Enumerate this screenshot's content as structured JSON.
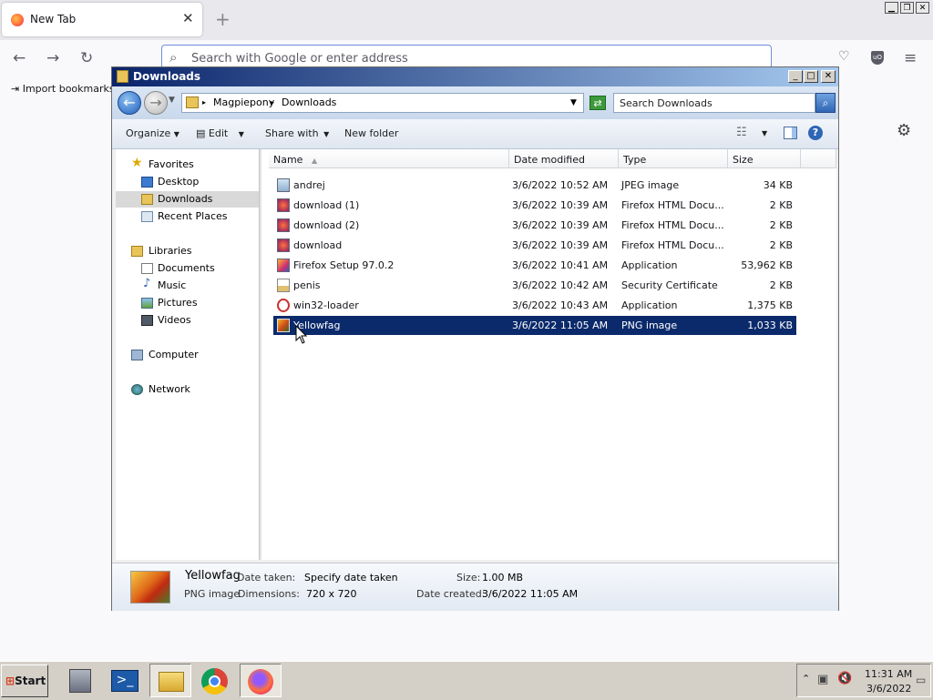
{
  "firefox": {
    "tab_title": "New Tab",
    "tab_close": "✕",
    "new_tab": "+",
    "address_placeholder": "Search with Google or enter address",
    "import_bookmarks": "Import bookmarks..."
  },
  "explorer": {
    "window_title": "Downloads",
    "breadcrumb": [
      "Magpiepony",
      "Downloads"
    ],
    "search_placeholder": "Search Downloads",
    "toolbar": {
      "organize": "Organize",
      "edit": "Edit",
      "share_with": "Share with",
      "new_folder": "New folder"
    },
    "nav": {
      "favorites": "Favorites",
      "desktop": "Desktop",
      "downloads": "Downloads",
      "recent_places": "Recent Places",
      "libraries": "Libraries",
      "documents": "Documents",
      "music": "Music",
      "pictures": "Pictures",
      "videos": "Videos",
      "computer": "Computer",
      "network": "Network"
    },
    "columns": {
      "name": "Name",
      "date_modified": "Date modified",
      "type": "Type",
      "size": "Size"
    },
    "files": [
      {
        "name": "andrej",
        "date": "3/6/2022 10:52 AM",
        "type": "JPEG image",
        "size": "34 KB",
        "icon": "image-file-icon"
      },
      {
        "name": "download (1)",
        "date": "3/6/2022 10:39 AM",
        "type": "Firefox HTML Docu...",
        "size": "2 KB",
        "icon": "html-file-icon"
      },
      {
        "name": "download (2)",
        "date": "3/6/2022 10:39 AM",
        "type": "Firefox HTML Docu...",
        "size": "2 KB",
        "icon": "html-file-icon"
      },
      {
        "name": "download",
        "date": "3/6/2022 10:39 AM",
        "type": "Firefox HTML Docu...",
        "size": "2 KB",
        "icon": "html-file-icon"
      },
      {
        "name": "Firefox Setup 97.0.2",
        "date": "3/6/2022 10:41 AM",
        "type": "Application",
        "size": "53,962 KB",
        "icon": "installer-icon"
      },
      {
        "name": "penis",
        "date": "3/6/2022 10:42 AM",
        "type": "Security Certificate",
        "size": "2 KB",
        "icon": "certificate-icon"
      },
      {
        "name": "win32-loader",
        "date": "3/6/2022 10:43 AM",
        "type": "Application",
        "size": "1,375 KB",
        "icon": "app-icon"
      },
      {
        "name": "Yellowfag",
        "date": "3/6/2022 11:05 AM",
        "type": "PNG image",
        "size": "1,033 KB",
        "icon": "png-file-icon",
        "selected": true
      }
    ],
    "details": {
      "name": "Yellowfag",
      "type": "PNG image",
      "date_taken_label": "Date taken:",
      "date_taken_value": "Specify date taken",
      "dimensions_label": "Dimensions:",
      "dimensions_value": "720 x 720",
      "size_label": "Size:",
      "size_value": "1.00 MB",
      "date_created_label": "Date created:",
      "date_created_value": "3/6/2022 11:05 AM"
    }
  },
  "taskbar": {
    "start": "Start",
    "time": "11:31 AM",
    "date": "3/6/2022"
  },
  "colors": {
    "selection": "#0b2a6b",
    "titlebar_start": "#0a246a",
    "titlebar_end": "#a6caf0"
  }
}
